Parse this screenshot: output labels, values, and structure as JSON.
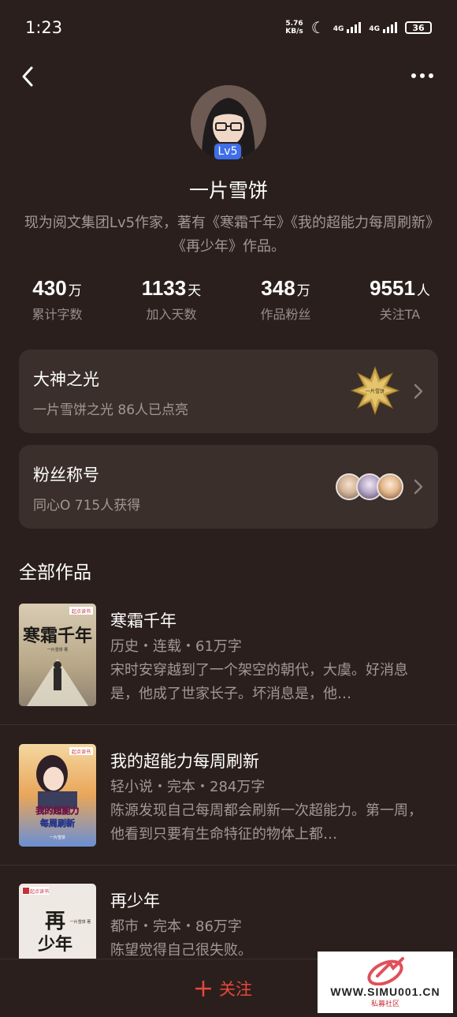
{
  "status": {
    "time": "1:23",
    "netspeed_value": "5.76",
    "netspeed_unit": "KB/s",
    "sig1_label": "4G",
    "sig2_label": "4G",
    "battery": "36"
  },
  "profile": {
    "name": "一片雪饼",
    "level_badge": "Lv5",
    "bio": "现为阅文集团Lv5作家，著有《寒霜千年》《我的超能力每周刷新》《再少年》作品。"
  },
  "stats": [
    {
      "num": "430",
      "unit": "万",
      "label": "累计字数"
    },
    {
      "num": "1133",
      "unit": "天",
      "label": "加入天数"
    },
    {
      "num": "348",
      "unit": "万",
      "label": "作品粉丝"
    },
    {
      "num": "9551",
      "unit": "人",
      "label": "关注TA"
    }
  ],
  "cards": {
    "master": {
      "title": "大神之光",
      "subtitle": "一片雪饼之光  86人已点亮",
      "medal_text": "一片雪饼"
    },
    "fans": {
      "title": "粉丝称号",
      "subtitle": "同心O  715人获得"
    }
  },
  "works": {
    "title": "全部作品",
    "books": [
      {
        "title": "寒霜千年",
        "meta": "历史・连载・61万字",
        "desc": "宋时安穿越到了一个架空的朝代，大虞。好消息是，他成了世家长子。坏消息是，他…",
        "cover_title": "寒霜千年",
        "cover_brand": "起点读书",
        "cover_author": "一片雪饼 著",
        "cover_bg": "#c9b9a0"
      },
      {
        "title": "我的超能力每周刷新",
        "meta": "轻小说・完本・284万字",
        "desc": "陈源发现自己每周都会刷新一次超能力。第一周，他看到只要有生命特征的物体上都…",
        "cover_title": "我的超能力每周刷新",
        "cover_brand": "起点读书",
        "cover_author": "一片雪饼",
        "cover_bg": "#e7a95c"
      },
      {
        "title": "再少年",
        "meta": "都市・完本・86万字",
        "desc": "陈望觉得自己很失败。",
        "cover_title": "再少年",
        "cover_brand": "起点读书",
        "cover_author": "一片雪饼 著",
        "cover_bg": "#efe9e3"
      }
    ]
  },
  "bottom": {
    "follow_label": "关注"
  },
  "watermark": {
    "url": "WWW.SIMU001.CN",
    "sub": "私募社区"
  }
}
